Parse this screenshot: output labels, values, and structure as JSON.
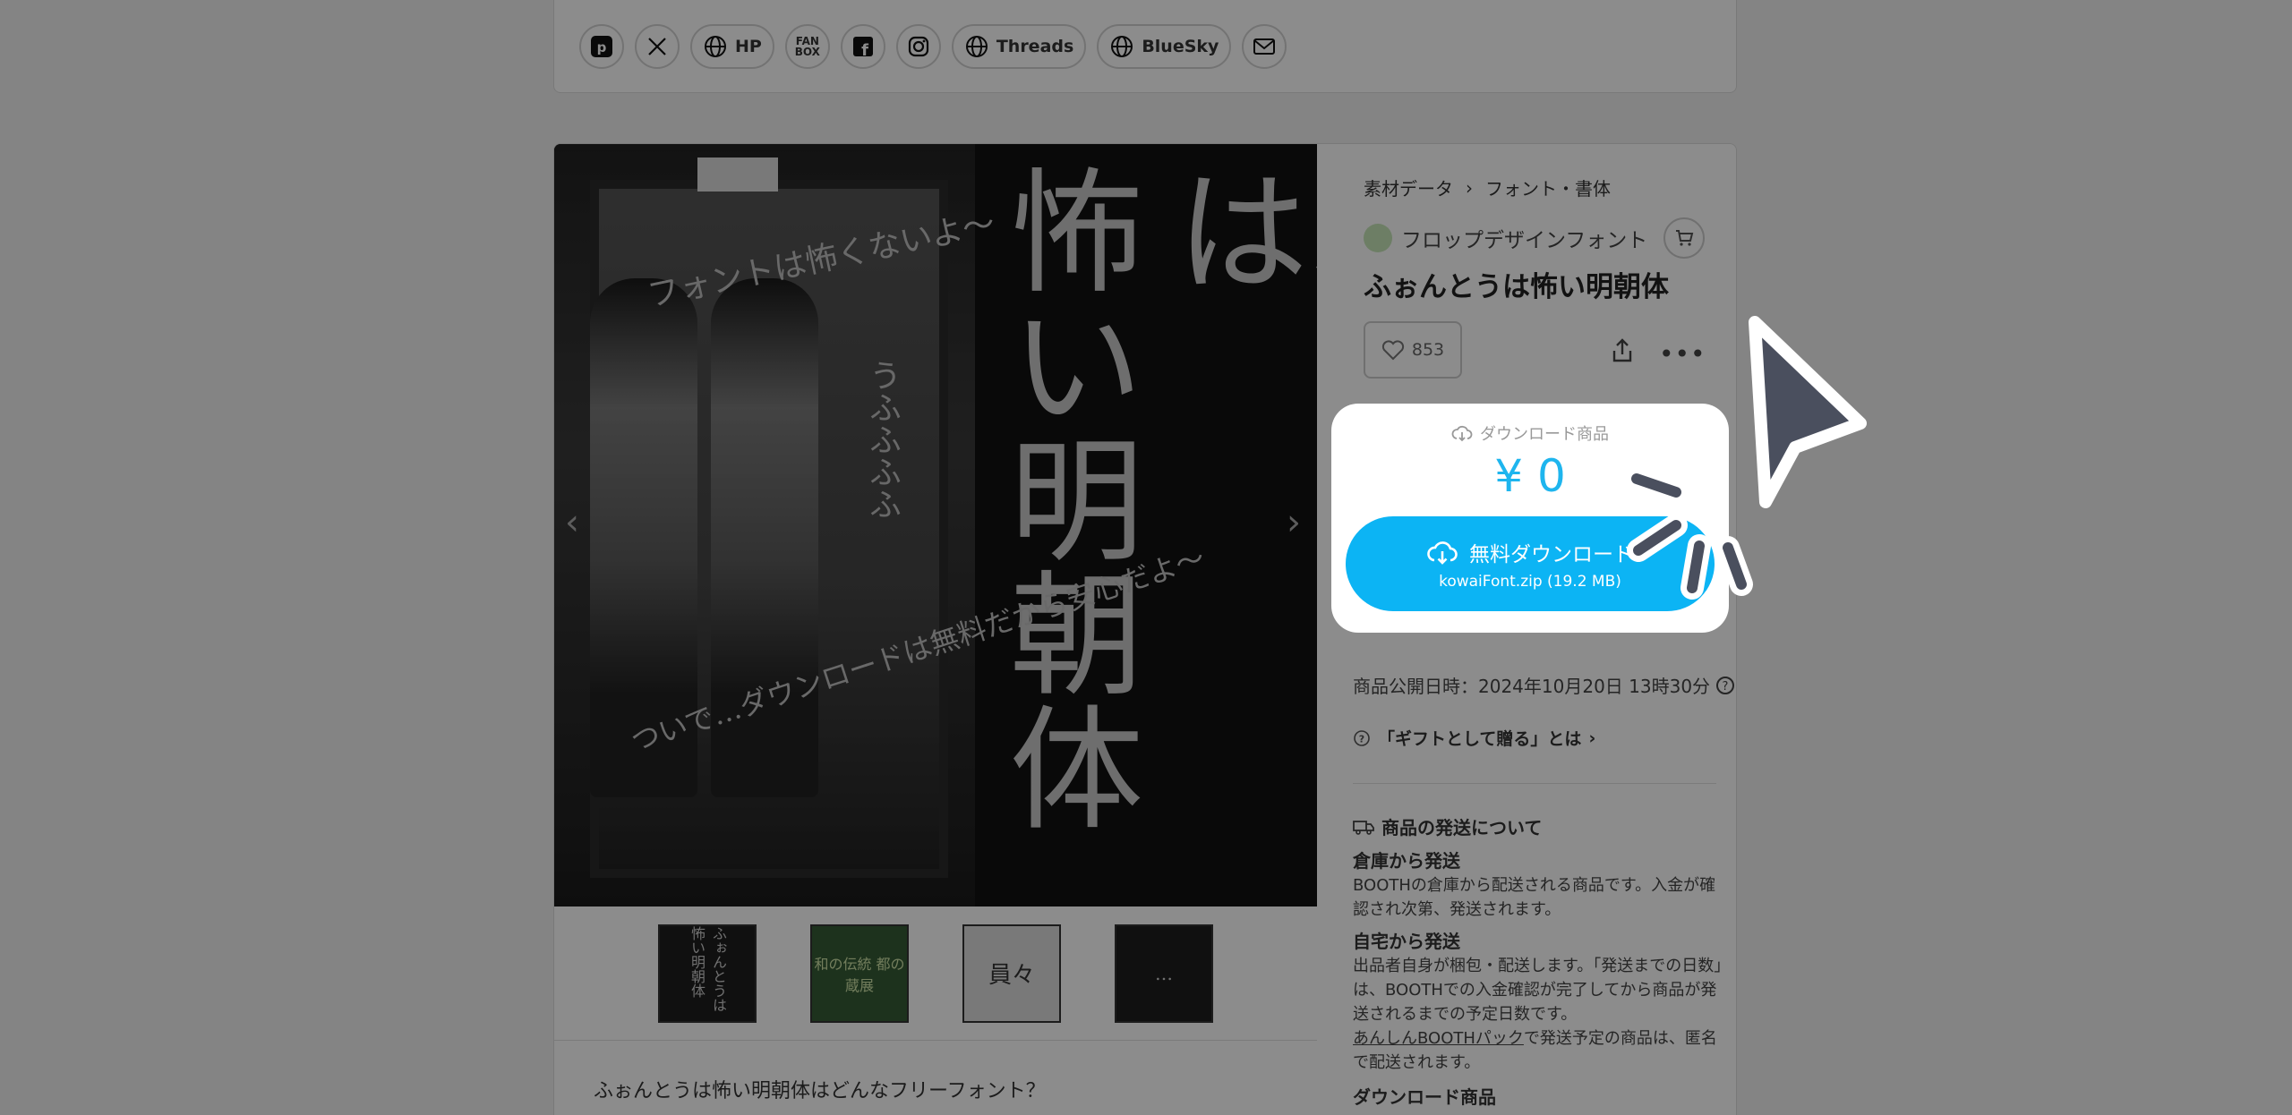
{
  "social": [
    {
      "label": "",
      "icon": "pixiv-icon"
    },
    {
      "label": "",
      "icon": "x-icon"
    },
    {
      "label": "HP",
      "icon": "globe-icon"
    },
    {
      "label": "FAN BOX",
      "icon": "fanbox-icon"
    },
    {
      "label": "",
      "icon": "facebook-icon"
    },
    {
      "label": "",
      "icon": "instagram-icon"
    },
    {
      "label": "Threads",
      "icon": "globe-icon"
    },
    {
      "label": "BlueSky",
      "icon": "globe-icon"
    },
    {
      "label": "",
      "icon": "mail-icon"
    }
  ],
  "gallery": {
    "title_line1": "ふぉんとうは",
    "title_line2": "怖い明朝体",
    "sub_vertical": "うふふふふ",
    "curvy_top": "フォントは怖くないよ〜",
    "curvy_bottom": "ついで…ダウンロードは無料だから安心だよ〜",
    "thumbs": [
      "ふぉんとうは怖い明朝体",
      "和の伝統 都の蔵展",
      "員々",
      "…"
    ]
  },
  "description_first": "ふぉんとうは怖い明朝体はどんなフリーフォント？",
  "breadcrumb": {
    "cat1": "素材データ",
    "cat2": "フォント・書体"
  },
  "shop_name": "フロップデザインフォント",
  "item_title": "ふぉんとうは怖い明朝体",
  "likes": "853",
  "buy": {
    "type": "ダウンロード商品",
    "price": "¥ 0",
    "button": "無料ダウンロード",
    "file": "kowaiFont.zip (19.2 MB)"
  },
  "pub_date": "商品公開日時：2024年10月20日 13時30分",
  "gift_link": "「ギフトとして贈る」とは",
  "shipping": {
    "heading": "商品の発送について",
    "warehouse_title": "倉庫から発送",
    "warehouse_text": "BOOTHの倉庫から配送される商品です。入金が確認され次第、発送されます。",
    "self_title": "自宅から発送",
    "self_text": "出品者自身が梱包・配送します。「発送までの日数」は、BOOTHでの入金確認が完了してから商品が発送されるまでの予定日数です。",
    "anshin_link": "あんしんBOOTHパック",
    "anshin_text": "で発送予定の商品は、匿名で配送されます。",
    "download_title": "ダウンロード商品"
  },
  "colors": {
    "accent": "#0cb4f4",
    "price": "#1eb5ee",
    "cursor": "#4a4f5e"
  }
}
